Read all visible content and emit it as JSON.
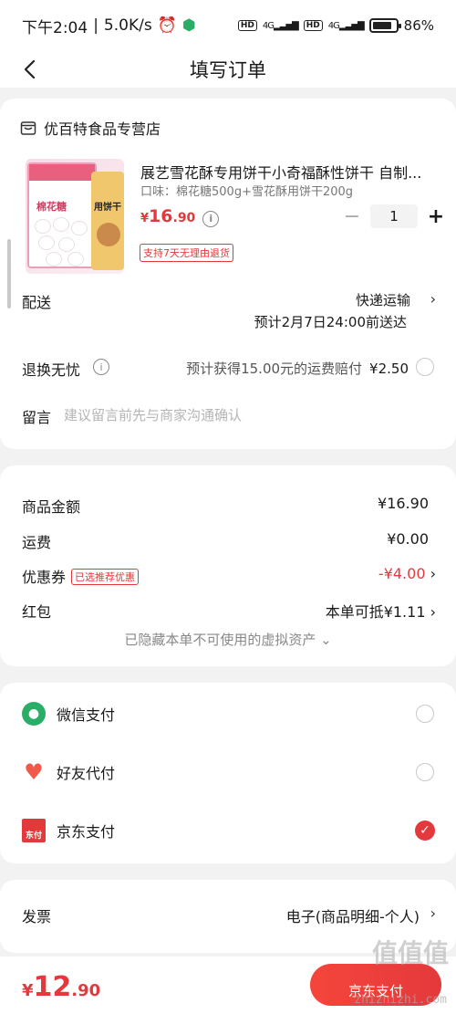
{
  "status_bar": {
    "time": "下午2:04",
    "speed": "5.0K/s",
    "hd": "HD",
    "network": "4G",
    "battery": "86%"
  },
  "nav": {
    "title": "填写订单"
  },
  "store": {
    "name": "优百特食品专营店"
  },
  "product": {
    "title": "展艺雪花酥专用饼干小奇福酥性饼干 自制...",
    "variant": "口味：棉花糖500g+雪花酥用饼干200g",
    "price_yen": "¥",
    "price_int": "16",
    "price_dec": ".90",
    "quantity": "1",
    "minus": "−",
    "plus": "+",
    "return_badge": "支持7天无理由退货",
    "image_text": {
      "left_label": "棉花糖",
      "right_label": "用饼干"
    }
  },
  "shipping": {
    "label": "配送",
    "method": "快递运输",
    "eta": "预计2月7日24:00前送达"
  },
  "insurance": {
    "label": "退换无忧",
    "desc": "预计获得15.00元的运费赔付",
    "fee": "¥2.50"
  },
  "message": {
    "label": "留言",
    "placeholder": "建议留言前先与商家沟通确认"
  },
  "amounts": {
    "goods_label": "商品金额",
    "goods_value": "¥16.90",
    "freight_label": "运费",
    "freight_value": "¥0.00",
    "coupon_label": "优惠券",
    "coupon_tag": "已选推荐优惠",
    "coupon_value": "-¥4.00",
    "redpack_label": "红包",
    "redpack_value": "本单可抵¥1.11",
    "hidden_assets": "已隐藏本单不可使用的虚拟资产 ⌄"
  },
  "payment": {
    "methods": [
      {
        "label": "微信支付",
        "selected": false
      },
      {
        "label": "好友代付",
        "selected": false
      },
      {
        "label": "京东支付",
        "selected": true
      }
    ],
    "jd_icon_text": "东付"
  },
  "invoice": {
    "label": "发票",
    "value": "电子(商品明细-个人)"
  },
  "footer": {
    "total_yen": "¥",
    "total_int": "12",
    "total_dec": ".90",
    "pay_button": "京东支付"
  },
  "watermark": {
    "text": "值值值",
    "url": "zhizhizhi.com"
  },
  "colors": {
    "accent": "#e4393c",
    "wechat": "#2aae67"
  }
}
